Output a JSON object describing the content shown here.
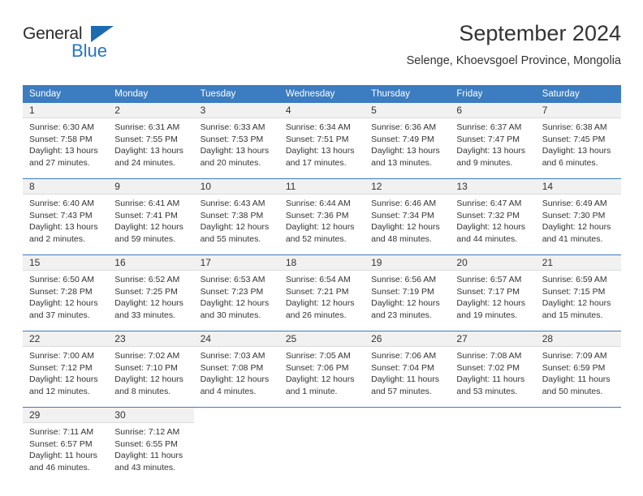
{
  "logo": {
    "word_one": "General",
    "word_two": "Blue",
    "triangle_icon": "blue-triangle-icon",
    "brand_color": "#2277c8"
  },
  "header": {
    "title": "September 2024",
    "subtitle": "Selenge, Khoevsgoel Province, Mongolia"
  },
  "theme": {
    "header_blue": "#3c7cc0",
    "daynum_band": "#f1f1f1",
    "text": "#333333"
  },
  "calendar": {
    "weekdays": [
      "Sunday",
      "Monday",
      "Tuesday",
      "Wednesday",
      "Thursday",
      "Friday",
      "Saturday"
    ],
    "weeks": [
      [
        {
          "day": "1",
          "sunrise": "Sunrise: 6:30 AM",
          "sunset": "Sunset: 7:58 PM",
          "daylight": "Daylight: 13 hours and 27 minutes."
        },
        {
          "day": "2",
          "sunrise": "Sunrise: 6:31 AM",
          "sunset": "Sunset: 7:55 PM",
          "daylight": "Daylight: 13 hours and 24 minutes."
        },
        {
          "day": "3",
          "sunrise": "Sunrise: 6:33 AM",
          "sunset": "Sunset: 7:53 PM",
          "daylight": "Daylight: 13 hours and 20 minutes."
        },
        {
          "day": "4",
          "sunrise": "Sunrise: 6:34 AM",
          "sunset": "Sunset: 7:51 PM",
          "daylight": "Daylight: 13 hours and 17 minutes."
        },
        {
          "day": "5",
          "sunrise": "Sunrise: 6:36 AM",
          "sunset": "Sunset: 7:49 PM",
          "daylight": "Daylight: 13 hours and 13 minutes."
        },
        {
          "day": "6",
          "sunrise": "Sunrise: 6:37 AM",
          "sunset": "Sunset: 7:47 PM",
          "daylight": "Daylight: 13 hours and 9 minutes."
        },
        {
          "day": "7",
          "sunrise": "Sunrise: 6:38 AM",
          "sunset": "Sunset: 7:45 PM",
          "daylight": "Daylight: 13 hours and 6 minutes."
        }
      ],
      [
        {
          "day": "8",
          "sunrise": "Sunrise: 6:40 AM",
          "sunset": "Sunset: 7:43 PM",
          "daylight": "Daylight: 13 hours and 2 minutes."
        },
        {
          "day": "9",
          "sunrise": "Sunrise: 6:41 AM",
          "sunset": "Sunset: 7:41 PM",
          "daylight": "Daylight: 12 hours and 59 minutes."
        },
        {
          "day": "10",
          "sunrise": "Sunrise: 6:43 AM",
          "sunset": "Sunset: 7:38 PM",
          "daylight": "Daylight: 12 hours and 55 minutes."
        },
        {
          "day": "11",
          "sunrise": "Sunrise: 6:44 AM",
          "sunset": "Sunset: 7:36 PM",
          "daylight": "Daylight: 12 hours and 52 minutes."
        },
        {
          "day": "12",
          "sunrise": "Sunrise: 6:46 AM",
          "sunset": "Sunset: 7:34 PM",
          "daylight": "Daylight: 12 hours and 48 minutes."
        },
        {
          "day": "13",
          "sunrise": "Sunrise: 6:47 AM",
          "sunset": "Sunset: 7:32 PM",
          "daylight": "Daylight: 12 hours and 44 minutes."
        },
        {
          "day": "14",
          "sunrise": "Sunrise: 6:49 AM",
          "sunset": "Sunset: 7:30 PM",
          "daylight": "Daylight: 12 hours and 41 minutes."
        }
      ],
      [
        {
          "day": "15",
          "sunrise": "Sunrise: 6:50 AM",
          "sunset": "Sunset: 7:28 PM",
          "daylight": "Daylight: 12 hours and 37 minutes."
        },
        {
          "day": "16",
          "sunrise": "Sunrise: 6:52 AM",
          "sunset": "Sunset: 7:25 PM",
          "daylight": "Daylight: 12 hours and 33 minutes."
        },
        {
          "day": "17",
          "sunrise": "Sunrise: 6:53 AM",
          "sunset": "Sunset: 7:23 PM",
          "daylight": "Daylight: 12 hours and 30 minutes."
        },
        {
          "day": "18",
          "sunrise": "Sunrise: 6:54 AM",
          "sunset": "Sunset: 7:21 PM",
          "daylight": "Daylight: 12 hours and 26 minutes."
        },
        {
          "day": "19",
          "sunrise": "Sunrise: 6:56 AM",
          "sunset": "Sunset: 7:19 PM",
          "daylight": "Daylight: 12 hours and 23 minutes."
        },
        {
          "day": "20",
          "sunrise": "Sunrise: 6:57 AM",
          "sunset": "Sunset: 7:17 PM",
          "daylight": "Daylight: 12 hours and 19 minutes."
        },
        {
          "day": "21",
          "sunrise": "Sunrise: 6:59 AM",
          "sunset": "Sunset: 7:15 PM",
          "daylight": "Daylight: 12 hours and 15 minutes."
        }
      ],
      [
        {
          "day": "22",
          "sunrise": "Sunrise: 7:00 AM",
          "sunset": "Sunset: 7:12 PM",
          "daylight": "Daylight: 12 hours and 12 minutes."
        },
        {
          "day": "23",
          "sunrise": "Sunrise: 7:02 AM",
          "sunset": "Sunset: 7:10 PM",
          "daylight": "Daylight: 12 hours and 8 minutes."
        },
        {
          "day": "24",
          "sunrise": "Sunrise: 7:03 AM",
          "sunset": "Sunset: 7:08 PM",
          "daylight": "Daylight: 12 hours and 4 minutes."
        },
        {
          "day": "25",
          "sunrise": "Sunrise: 7:05 AM",
          "sunset": "Sunset: 7:06 PM",
          "daylight": "Daylight: 12 hours and 1 minute."
        },
        {
          "day": "26",
          "sunrise": "Sunrise: 7:06 AM",
          "sunset": "Sunset: 7:04 PM",
          "daylight": "Daylight: 11 hours and 57 minutes."
        },
        {
          "day": "27",
          "sunrise": "Sunrise: 7:08 AM",
          "sunset": "Sunset: 7:02 PM",
          "daylight": "Daylight: 11 hours and 53 minutes."
        },
        {
          "day": "28",
          "sunrise": "Sunrise: 7:09 AM",
          "sunset": "Sunset: 6:59 PM",
          "daylight": "Daylight: 11 hours and 50 minutes."
        }
      ],
      [
        {
          "day": "29",
          "sunrise": "Sunrise: 7:11 AM",
          "sunset": "Sunset: 6:57 PM",
          "daylight": "Daylight: 11 hours and 46 minutes."
        },
        {
          "day": "30",
          "sunrise": "Sunrise: 7:12 AM",
          "sunset": "Sunset: 6:55 PM",
          "daylight": "Daylight: 11 hours and 43 minutes."
        },
        {
          "day": "",
          "sunrise": "",
          "sunset": "",
          "daylight": ""
        },
        {
          "day": "",
          "sunrise": "",
          "sunset": "",
          "daylight": ""
        },
        {
          "day": "",
          "sunrise": "",
          "sunset": "",
          "daylight": ""
        },
        {
          "day": "",
          "sunrise": "",
          "sunset": "",
          "daylight": ""
        },
        {
          "day": "",
          "sunrise": "",
          "sunset": "",
          "daylight": ""
        }
      ]
    ]
  }
}
